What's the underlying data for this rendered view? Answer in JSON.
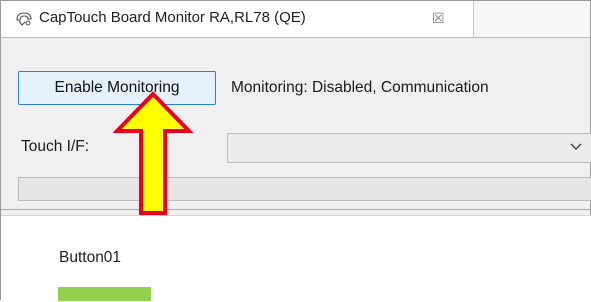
{
  "tab": {
    "title": "CapTouch Board Monitor RA,RL78 (QE)",
    "close_glyph": "☒",
    "icon": "monitor-view-icon"
  },
  "toolbar": {
    "enable_label": "Enable Monitoring",
    "status": "Monitoring: Disabled, Communication"
  },
  "touch": {
    "label": "Touch I/F:",
    "selected_value": ""
  },
  "progress": {
    "value": 0
  },
  "canvas": {
    "button_label": "Button01",
    "button_color": "#92d050"
  },
  "annotation": {
    "arrow_fill": "#ffff00",
    "arrow_stroke": "#e8001c"
  }
}
